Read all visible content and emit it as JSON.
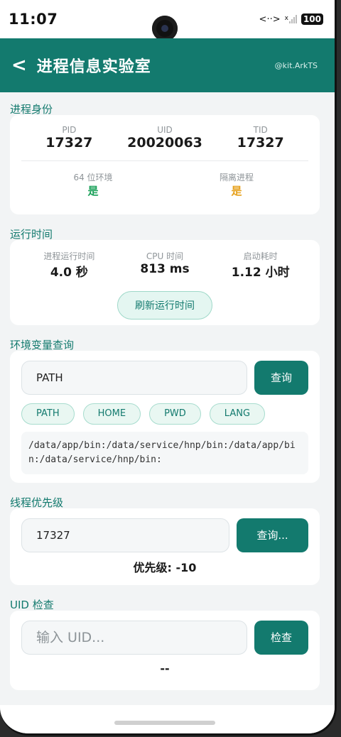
{
  "status": {
    "time": "11:07",
    "net": "<··>",
    "signal_x": "x",
    "battery": "100"
  },
  "header": {
    "back": "<",
    "title": "进程信息实验室",
    "tag": "@kit.ArkTS"
  },
  "identity": {
    "section": "进程身份",
    "pid_label": "PID",
    "pid": "17327",
    "uid_label": "UID",
    "uid": "20020063",
    "tid_label": "TID",
    "tid": "17327",
    "env64_label": "64 位环境",
    "env64": "是",
    "isolated_label": "隔离进程",
    "isolated": "是"
  },
  "runtime": {
    "section": "运行时间",
    "proc_label": "进程运行时间",
    "proc": "4.0 秒",
    "cpu_label": "CPU 时间",
    "cpu": "813 ms",
    "boot_label": "启动耗时",
    "boot": "1.12 小时",
    "refresh": "刷新运行时间"
  },
  "env": {
    "section": "环境变量查询",
    "input_value": "PATH",
    "query": "查询",
    "chips": [
      "PATH",
      "HOME",
      "PWD",
      "LANG"
    ],
    "result": "/data/app/bin:/data/service/hnp/bin:/data/app/bin:/data/service/hnp/bin:"
  },
  "priority": {
    "section": "线程优先级",
    "input_value": "17327",
    "query": "查询...",
    "result": "优先级: -10"
  },
  "uidcheck": {
    "section": "UID 检查",
    "placeholder": "输入 UID...",
    "check": "检查",
    "result": "--"
  }
}
